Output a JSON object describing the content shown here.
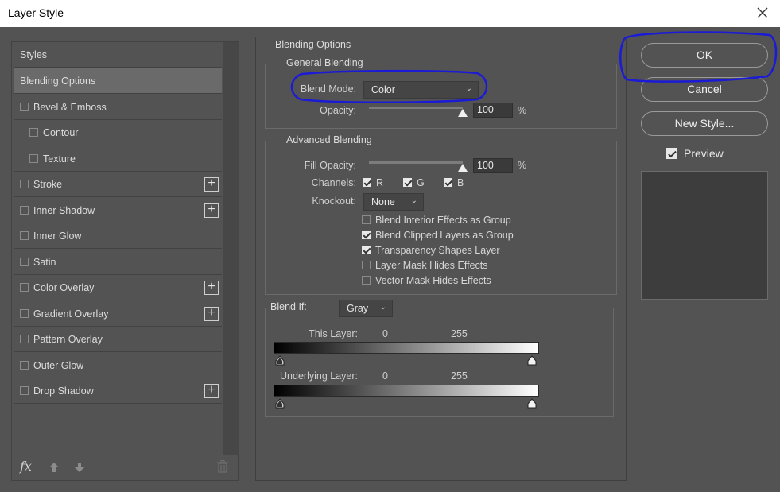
{
  "window": {
    "title": "Layer Style"
  },
  "styles_panel": {
    "header": "Styles",
    "items": [
      {
        "label": "Blending Options",
        "checkbox": false,
        "checked": false,
        "indent": 0,
        "selected": true,
        "has_add": false
      },
      {
        "label": "Bevel & Emboss",
        "checkbox": true,
        "checked": false,
        "indent": 0,
        "selected": false,
        "has_add": false
      },
      {
        "label": "Contour",
        "checkbox": true,
        "checked": false,
        "indent": 1,
        "selected": false,
        "has_add": false
      },
      {
        "label": "Texture",
        "checkbox": true,
        "checked": false,
        "indent": 1,
        "selected": false,
        "has_add": false
      },
      {
        "label": "Stroke",
        "checkbox": true,
        "checked": false,
        "indent": 0,
        "selected": false,
        "has_add": true
      },
      {
        "label": "Inner Shadow",
        "checkbox": true,
        "checked": false,
        "indent": 0,
        "selected": false,
        "has_add": true
      },
      {
        "label": "Inner Glow",
        "checkbox": true,
        "checked": false,
        "indent": 0,
        "selected": false,
        "has_add": false
      },
      {
        "label": "Satin",
        "checkbox": true,
        "checked": false,
        "indent": 0,
        "selected": false,
        "has_add": false
      },
      {
        "label": "Color Overlay",
        "checkbox": true,
        "checked": false,
        "indent": 0,
        "selected": false,
        "has_add": true
      },
      {
        "label": "Gradient Overlay",
        "checkbox": true,
        "checked": false,
        "indent": 0,
        "selected": false,
        "has_add": true
      },
      {
        "label": "Pattern Overlay",
        "checkbox": true,
        "checked": false,
        "indent": 0,
        "selected": false,
        "has_add": false
      },
      {
        "label": "Outer Glow",
        "checkbox": true,
        "checked": false,
        "indent": 0,
        "selected": false,
        "has_add": false
      },
      {
        "label": "Drop Shadow",
        "checkbox": true,
        "checked": false,
        "indent": 0,
        "selected": false,
        "has_add": true
      }
    ],
    "add_symbol": "+",
    "footer_icons": [
      "fx-icon",
      "move-up-icon",
      "move-down-icon",
      "trash-icon"
    ],
    "fx_label": "fx"
  },
  "blending_options": {
    "title": "Blending Options",
    "general": {
      "title": "General Blending",
      "blend_mode_label": "Blend Mode:",
      "blend_mode_value": "Color",
      "opacity_label": "Opacity:",
      "opacity_value": "100",
      "opacity_unit": "%",
      "opacity_fraction": 1.0
    },
    "advanced": {
      "title": "Advanced Blending",
      "fill_opacity_label": "Fill Opacity:",
      "fill_opacity_value": "100",
      "fill_opacity_unit": "%",
      "fill_opacity_fraction": 1.0,
      "channels_label": "Channels:",
      "channels": [
        {
          "label": "R",
          "checked": true
        },
        {
          "label": "G",
          "checked": true
        },
        {
          "label": "B",
          "checked": true
        }
      ],
      "knockout_label": "Knockout:",
      "knockout_value": "None",
      "options": [
        {
          "label": "Blend Interior Effects as Group",
          "checked": false
        },
        {
          "label": "Blend Clipped Layers as Group",
          "checked": true
        },
        {
          "label": "Transparency Shapes Layer",
          "checked": true
        },
        {
          "label": "Layer Mask Hides Effects",
          "checked": false
        },
        {
          "label": "Vector Mask Hides Effects",
          "checked": false
        }
      ]
    },
    "blend_if": {
      "label": "Blend If:",
      "value": "Gray",
      "this_layer_label": "This Layer:",
      "this_layer_min": "0",
      "this_layer_max": "255",
      "underlying_label": "Underlying Layer:",
      "underlying_min": "0",
      "underlying_max": "255"
    }
  },
  "buttons": {
    "ok": "OK",
    "cancel": "Cancel",
    "new_style": "New Style..."
  },
  "preview": {
    "label": "Preview",
    "checked": true
  },
  "colors": {
    "dialog_bg": "#535353",
    "selected_row": "#6a6a6a",
    "annotation": "#1b1bd6"
  }
}
